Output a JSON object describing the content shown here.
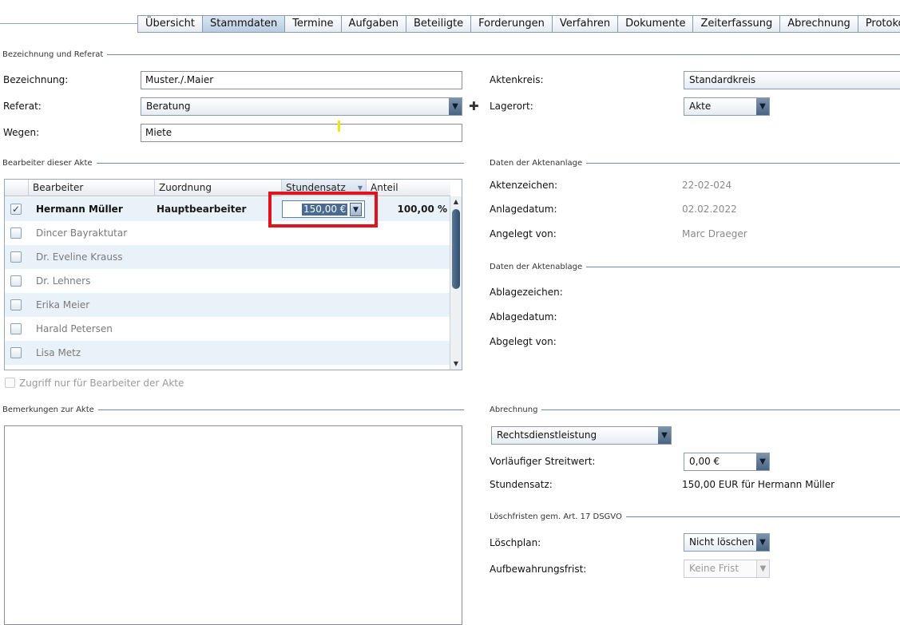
{
  "tabs": [
    {
      "label": "Übersicht",
      "active": false
    },
    {
      "label": "Stammdaten",
      "active": true
    },
    {
      "label": "Termine",
      "active": false
    },
    {
      "label": "Aufgaben",
      "active": false
    },
    {
      "label": "Beteiligte",
      "active": false
    },
    {
      "label": "Forderungen",
      "active": false
    },
    {
      "label": "Verfahren",
      "active": false
    },
    {
      "label": "Dokumente",
      "active": false
    },
    {
      "label": "Zeiterfassung",
      "active": false
    },
    {
      "label": "Abrechnung",
      "active": false
    },
    {
      "label": "Protokoll",
      "active": false
    }
  ],
  "bezeichnung_section": {
    "title": "Bezeichnung und Referat",
    "bezeichnung_label": "Bezeichnung:",
    "bezeichnung_value": "Muster./.Maier",
    "referat_label": "Referat:",
    "referat_value": "Beratung",
    "wegen_label": "Wegen:",
    "wegen_value": "Miete",
    "aktenkreis_label": "Aktenkreis:",
    "aktenkreis_value": "Standardkreis",
    "lagerort_label": "Lagerort:",
    "lagerort_value": "Akte"
  },
  "bearbeiter": {
    "title": "Bearbeiter dieser Akte",
    "columns": [
      "Bearbeiter",
      "Zuordnung",
      "Stundensatz",
      "Anteil"
    ],
    "rows": [
      {
        "name": "Hermann Müller",
        "checked": true,
        "zuordnung": "Hauptbearbeiter",
        "stundensatz": "150,00 €",
        "anteil": "100,00 %"
      },
      {
        "name": "Dincer Bayraktutar",
        "checked": false
      },
      {
        "name": "Dr. Eveline Krauss",
        "checked": false
      },
      {
        "name": "Dr. Lehners",
        "checked": false
      },
      {
        "name": "Erika Meier",
        "checked": false
      },
      {
        "name": "Harald Petersen",
        "checked": false
      },
      {
        "name": "Lisa Metz",
        "checked": false
      }
    ],
    "access_label": "Zugriff nur für Bearbeiter der Akte"
  },
  "anlage": {
    "title": "Daten der Aktenanlage",
    "aktenzeichen_label": "Aktenzeichen:",
    "aktenzeichen_value": "22-02-024",
    "anlagedatum_label": "Anlagedatum:",
    "anlagedatum_value": "02.02.2022",
    "angelegt_label": "Angelegt von:",
    "angelegt_value": "Marc Draeger"
  },
  "ablage": {
    "title": "Daten der Aktenablage",
    "ablagezeichen_label": "Ablagezeichen:",
    "ablagedatum_label": "Ablagedatum:",
    "abgelegt_label": "Abgelegt von:"
  },
  "bemerkungen": {
    "title": "Bemerkungen zur Akte",
    "text": ""
  },
  "abrechnung": {
    "title": "Abrechnung",
    "type_value": "Rechtsdienstleistung",
    "streitwert_label": "Vorläufiger Streitwert:",
    "streitwert_value": "0,00 €",
    "stundensatz_label": "Stundensatz:",
    "stundensatz_value": "150,00 EUR für Hermann Müller"
  },
  "loeschfristen": {
    "title": "Löschfristen gem. Art. 17 DSGVO",
    "loeschplan_label": "Löschplan:",
    "loeschplan_value": "Nicht löschen",
    "frist_label": "Aufbewahrungsfrist:",
    "frist_value": "Keine Frist"
  },
  "colors": {
    "accent": "#4a6b90",
    "highlight": "#e0141c",
    "tab_border": "#8a9bb0"
  }
}
